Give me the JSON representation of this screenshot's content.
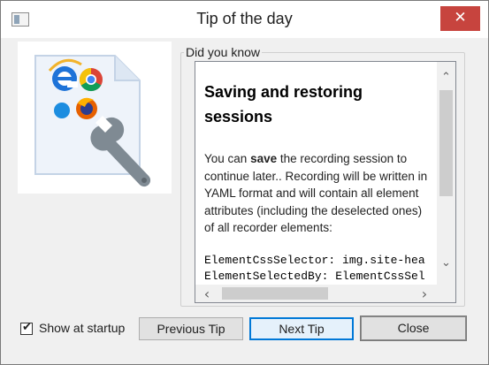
{
  "window": {
    "title": "Tip of the day",
    "close_glyph": "✕"
  },
  "group": {
    "label": "Did you know"
  },
  "tip": {
    "heading": "Saving and restoring sessions",
    "body_prefix": "You can ",
    "body_bold": "save",
    "body_suffix": " the recording session to continue later.. Recording will be written in YAML format and will contain all element attributes (including the deselected ones) of all recorder elements:",
    "code_lines": [
      "ElementCssSelector: img.site-hea",
      "ElementSelectedBy: ElementCssSel"
    ]
  },
  "footer": {
    "show_at_startup_label": "Show at startup",
    "show_at_startup_checked": true,
    "previous_label": "Previous Tip",
    "next_label": "Next Tip",
    "close_label": "Close"
  },
  "icons": {
    "check": "✔",
    "arrow_up": "⌃",
    "arrow_down": "⌄",
    "arrow_left": "‹",
    "arrow_right": "›"
  },
  "colors": {
    "close_bg": "#c7443e",
    "primary_border": "#0078d7",
    "wrench": "#7f8a93"
  }
}
